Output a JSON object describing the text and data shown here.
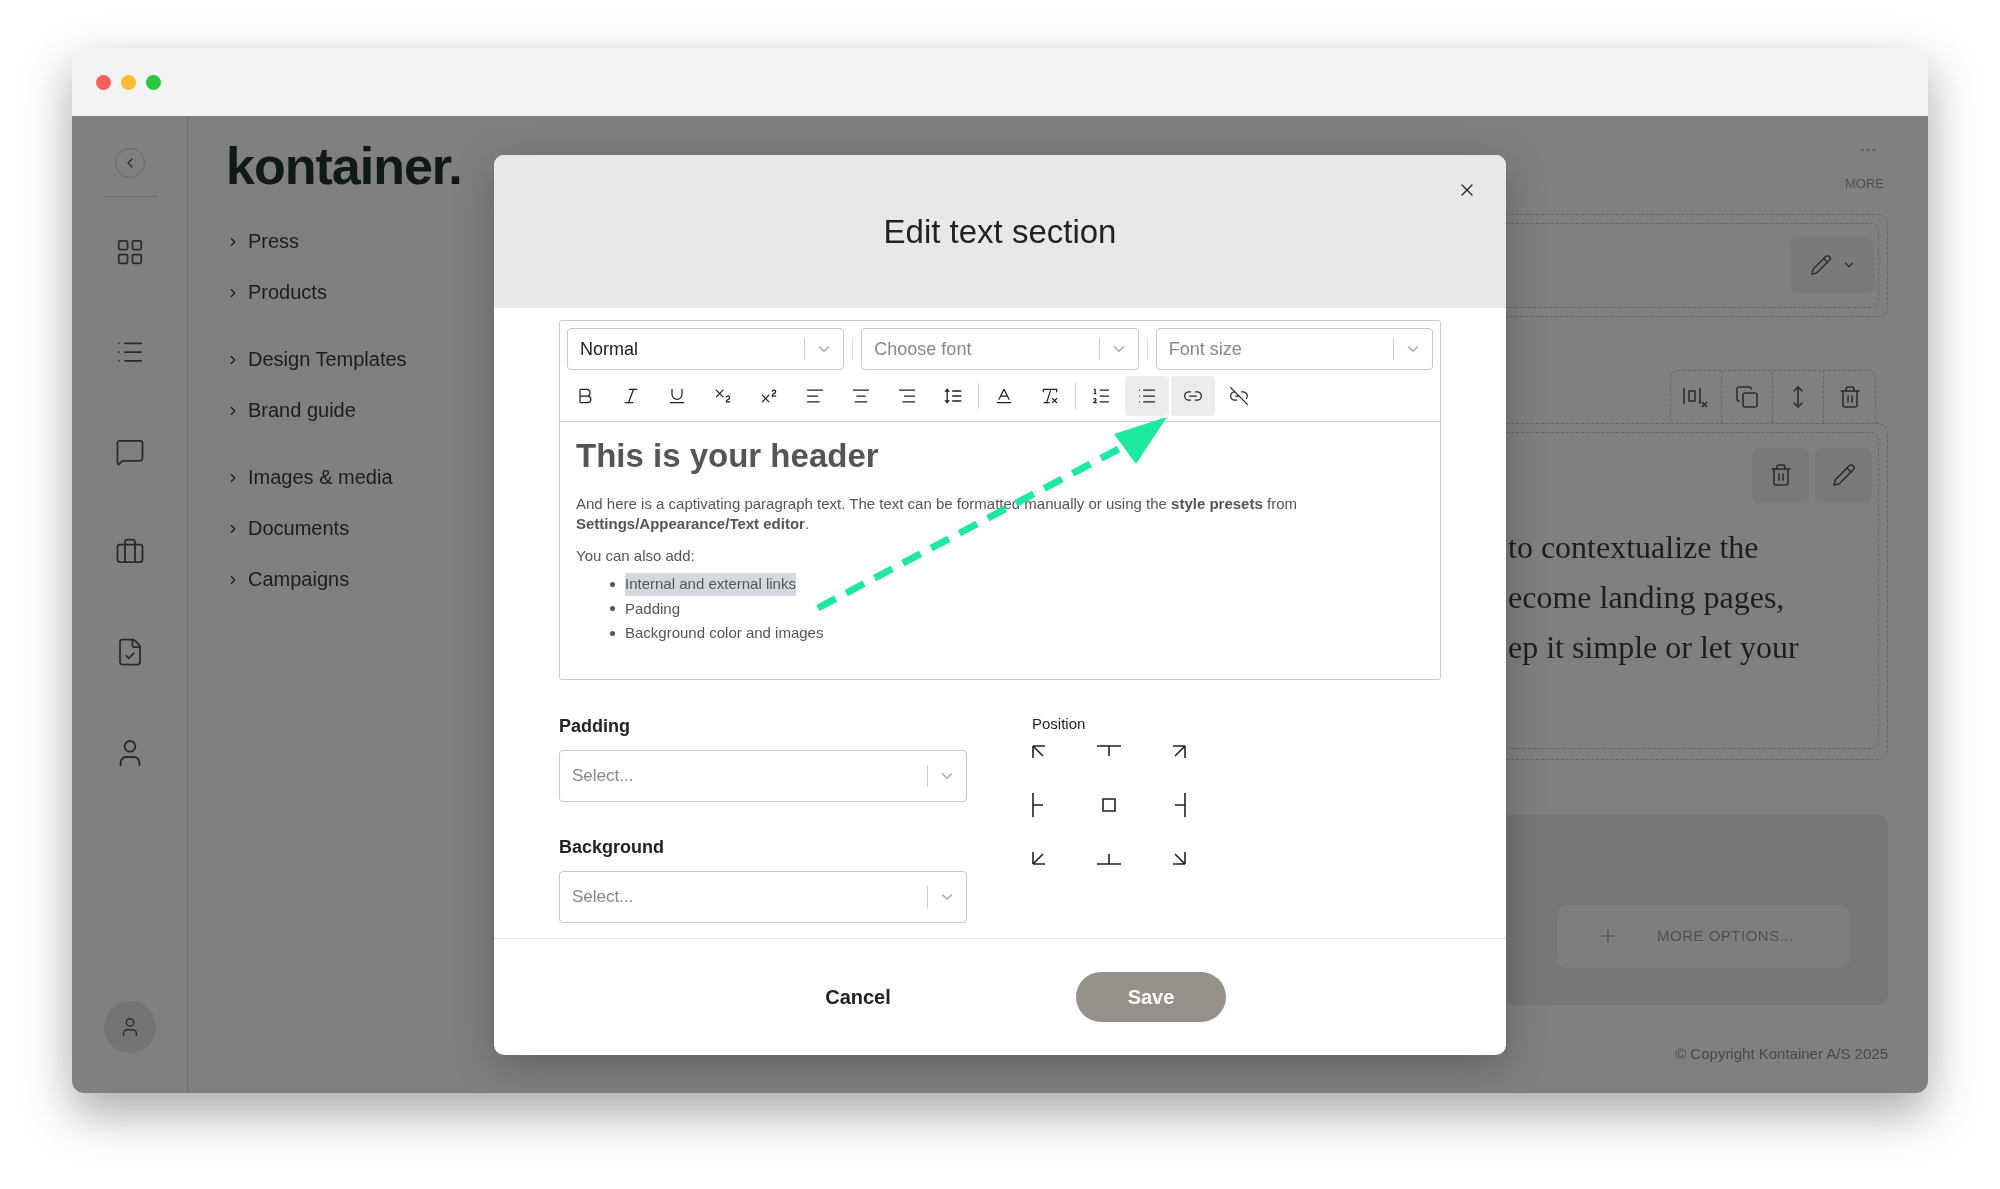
{
  "brand": "kontainer.",
  "nav": {
    "groups": [
      {
        "items": [
          "Press",
          "Products"
        ]
      },
      {
        "items": [
          "Design Templates",
          "Brand guide"
        ]
      },
      {
        "items": [
          "Images & media",
          "Documents",
          "Campaigns"
        ]
      }
    ]
  },
  "page": {
    "more_label": "MORE",
    "body_lines": [
      "to contextualize the",
      "ecome landing pages,",
      "ep it simple or let your"
    ],
    "more_options": "MORE OPTIONS...",
    "copyright": "© Copyright Kontainer A/S 2025"
  },
  "modal": {
    "title": "Edit text section",
    "toolbar": {
      "selects": [
        {
          "value": "Normal"
        },
        {
          "placeholder": "Choose font"
        },
        {
          "placeholder": "Font size"
        }
      ],
      "groups": [
        {
          "buttons": [
            {
              "kind": "bold",
              "active": false
            },
            {
              "kind": "italic",
              "active": false
            },
            {
              "kind": "underline",
              "active": false
            },
            {
              "kind": "subscript",
              "active": false
            },
            {
              "kind": "superscript",
              "active": false
            },
            {
              "kind": "align-left",
              "active": false
            },
            {
              "kind": "align-center",
              "active": false
            },
            {
              "kind": "align-right",
              "active": false
            },
            {
              "kind": "line-height",
              "active": false
            }
          ]
        },
        {
          "buttons": [
            {
              "kind": "text-color",
              "active": false
            },
            {
              "kind": "clear-format",
              "active": false
            }
          ]
        },
        {
          "buttons": [
            {
              "kind": "ordered-list",
              "active": false
            },
            {
              "kind": "bullet-list",
              "active": true
            },
            {
              "kind": "link",
              "active": true
            },
            {
              "kind": "unlink",
              "active": false
            }
          ]
        }
      ]
    },
    "editor": {
      "heading": "This is your header",
      "paragraph": "And here is a captivating paragraph text. The text can be formatted manually or using the **style presets** from **Settings/Appearance/Text editor**.",
      "intro": "You can also add:",
      "list": [
        {
          "text": "Internal and external links",
          "highlighted": true
        },
        {
          "text": "Padding",
          "highlighted": false
        },
        {
          "text": "Background color and images",
          "highlighted": false
        }
      ]
    },
    "fields": [
      {
        "label": "Padding",
        "placeholder": "Select..."
      },
      {
        "label": "Background",
        "placeholder": "Select..."
      }
    ],
    "position": {
      "label": "Position"
    },
    "cancel": "Cancel",
    "save": "Save"
  }
}
